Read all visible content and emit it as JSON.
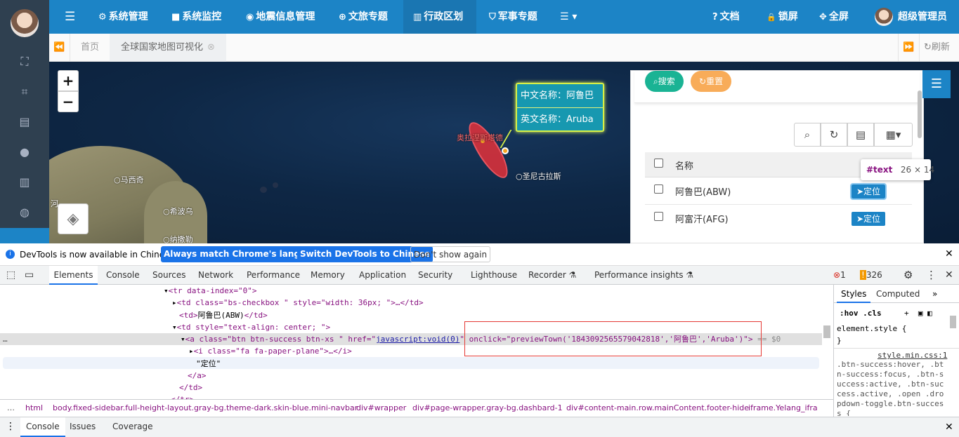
{
  "sidebar": {
    "icons": [
      "selection-icon",
      "connect-icon",
      "map-icon",
      "marker-icon",
      "bar-chart-icon",
      "globe-icon"
    ]
  },
  "topnav": {
    "items": [
      {
        "label": "系统管理",
        "icon": "⚙"
      },
      {
        "label": "系统监控",
        "icon": "■"
      },
      {
        "label": "地震信息管理",
        "icon": "◉"
      },
      {
        "label": "文旅专题",
        "icon": "⊕"
      },
      {
        "label": "行政区划",
        "icon": "▥"
      },
      {
        "label": "军事专题",
        "icon": "⛉"
      }
    ],
    "more_icon": "☰ ▾",
    "right": [
      {
        "label": "文档",
        "icon": "?"
      },
      {
        "label": "锁屏",
        "icon": "🔒"
      },
      {
        "label": "全屏",
        "icon": "✥"
      }
    ],
    "username": "超级管理员"
  },
  "tabs": {
    "home": "首页",
    "active": "全球国家地图可视化",
    "refresh": "刷新"
  },
  "map": {
    "zoom_in": "+",
    "zoom_out": "−",
    "labels": {
      "majiqi": "马西奇",
      "xibowu": "希波乌",
      "nabaile": "纳撒勒",
      "hedu": "河",
      "orange": "奥拉涅斯塔德",
      "santa": "圣尼古拉斯"
    },
    "popup": {
      "cn": "中文名称：阿鲁巴",
      "en": "英文名称：Aruba"
    }
  },
  "panel": {
    "search": "搜索",
    "reset": "重置",
    "column_name": "名称",
    "rows": [
      {
        "name": "阿鲁巴(ABW)",
        "action": "定位"
      },
      {
        "name": "阿富汗(AFG)",
        "action": "定位"
      }
    ],
    "tooltip": {
      "tag": "#text",
      "size": "26 × 14"
    }
  },
  "devtools": {
    "notice": {
      "text": "DevTools is now available in Chinese!",
      "btn1": "Always match Chrome's language",
      "btn2": "Switch DevTools to Chinese",
      "btn3": "Don't show again"
    },
    "tabs": [
      "Elements",
      "Console",
      "Sources",
      "Network",
      "Performance",
      "Memory",
      "Application",
      "Security",
      "Lighthouse",
      "Recorder ⚗",
      "Performance insights ⚗"
    ],
    "errors": "1",
    "warnings": "326",
    "code": {
      "l1": "<tr data-index=\"0\">",
      "l2a": "<td class=\"bs-checkbox \" style=\"width: 36px; \">…</td>",
      "l3a": "<td>",
      "l3b": "阿鲁巴(ABW)",
      "l3c": "</td>",
      "l4": "<td style=\"text-align: center; \">",
      "l5a": "<a class=\"btn btn-success btn-xs \" href=\"",
      "l5b": "javascript:void(0)",
      "l5c": "\" onclick=\"previewTown('1843092565579042818','阿鲁巴','Aruba')\">",
      "l5d": " == $0",
      "l6": "<i class=\"fa fa-paper-plane\">…</i>",
      "l7": "\"定位\"",
      "l8": "</a>",
      "l9": "</td>",
      "l10": "</tr>"
    },
    "styles": {
      "tabs": [
        "Styles",
        "Computed"
      ],
      "filter": ":hov .cls",
      "rule1": "element.style {",
      "rule1end": "}",
      "sel": ".btn-success:hover, .btn-success:focus, .btn-success:active, .btn-success.active, .open .dropdown-toggle.btn-success {",
      "source": "style.min.css:1"
    },
    "crumbs": [
      "html",
      "body.fixed-sidebar.full-height-layout.gray-bg.theme-dark.skin-blue.mini-navbar",
      "div#wrapper",
      "div#page-wrapper.gray-bg.dashbard-1",
      "div#content-main.row.mainContent.footer-hide",
      "iframe.Yelang_ifra"
    ],
    "drawer": [
      "Console",
      "Issues",
      "Coverage"
    ]
  }
}
